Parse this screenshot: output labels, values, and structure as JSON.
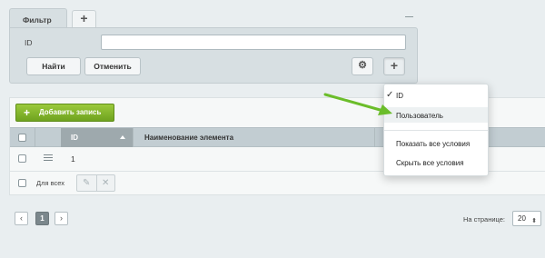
{
  "filter": {
    "tab_label": "Фильтр",
    "add_tab_label": "+",
    "id_label": "ID",
    "id_value": "",
    "find_label": "Найти",
    "cancel_label": "Отменить",
    "settings_icon": "gear-icon",
    "add_field_icon": "plus-icon",
    "gear_glyph": "⚙",
    "plus_glyph": "+"
  },
  "toolbar": {
    "add_record_label": "Добавить запись",
    "add_record_glyph": "+"
  },
  "grid": {
    "columns": [
      "ID",
      "Наименование элемента"
    ],
    "rows": [
      {
        "id": "1"
      }
    ],
    "for_all_label": "Для всех",
    "edit_glyph": "✎",
    "delete_glyph": "✕"
  },
  "pagination": {
    "prev": "‹",
    "current_page": "1",
    "next": "›",
    "per_page_label": "На странице:",
    "per_page_value": "20",
    "select_arrow": "⬍"
  },
  "dropdown": {
    "check_glyph": "✓",
    "items": [
      "ID",
      "Пользователь",
      "Показать все условия",
      "Скрыть все условия"
    ],
    "checked_item": "ID",
    "hovered_item": "Пользователь"
  },
  "colors": {
    "accent_green": "#7ab42c",
    "annotation_arrow": "#6bbd2a",
    "background": "#e9eef0"
  }
}
